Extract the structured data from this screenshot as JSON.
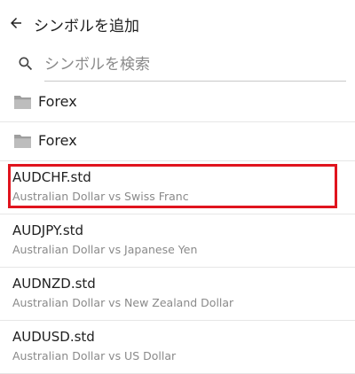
{
  "header": {
    "back_icon": "arrow-left-icon",
    "title": "シンボルを追加"
  },
  "search": {
    "icon": "search-icon",
    "placeholder": "シンボルを検索",
    "value": ""
  },
  "folders": [
    {
      "icon": "folder-icon",
      "label": "Forex"
    },
    {
      "icon": "folder-icon",
      "label": "Forex"
    }
  ],
  "symbols": [
    {
      "name": "AUDCHF.std",
      "description": "Australian Dollar vs Swiss Franc",
      "highlighted": true
    },
    {
      "name": "AUDJPY.std",
      "description": "Australian Dollar vs Japanese Yen"
    },
    {
      "name": "AUDNZD.std",
      "description": "Australian Dollar vs New Zealand Dollar"
    },
    {
      "name": "AUDUSD.std",
      "description": "Australian Dollar vs US Dollar"
    }
  ],
  "colors": {
    "highlight": "#e0141e",
    "folder": "#9e9e9e",
    "secondary_text": "#8a8a8a"
  }
}
